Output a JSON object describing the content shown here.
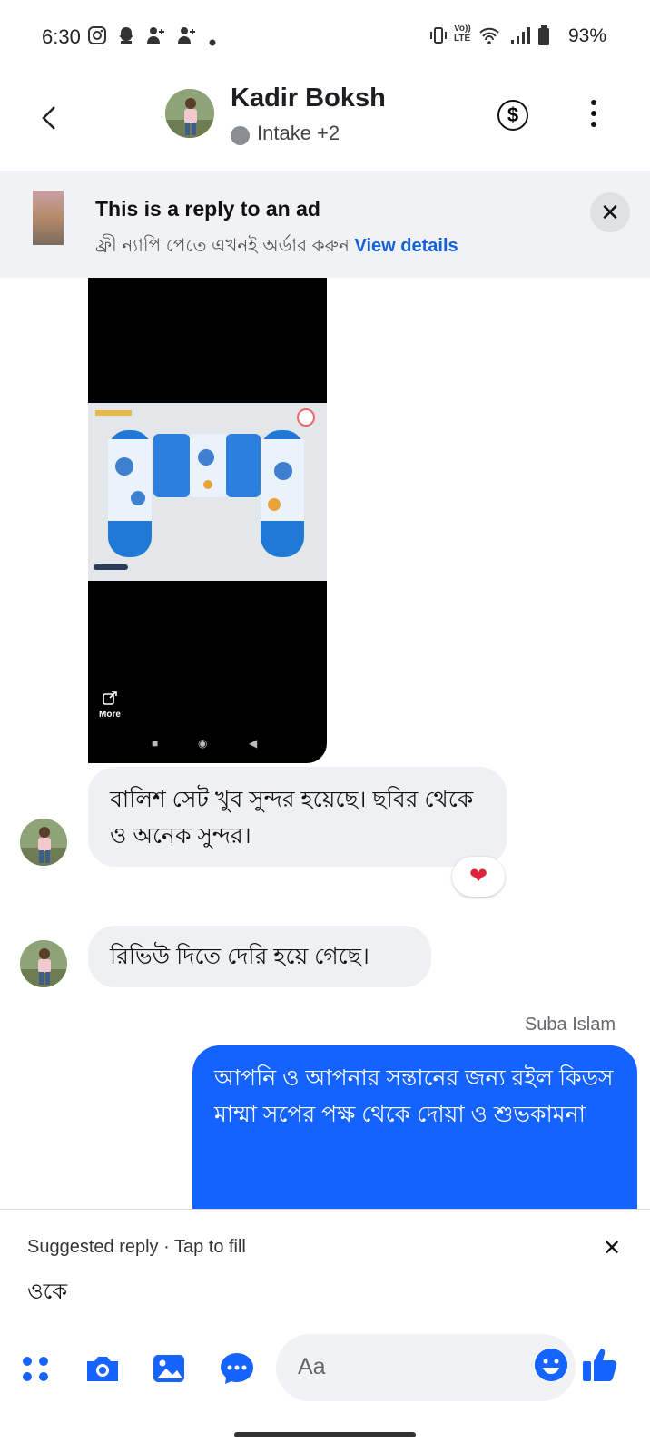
{
  "status_bar": {
    "time": "6:30",
    "battery": "93%",
    "network": "Vo))\nLTE"
  },
  "header": {
    "name": "Kadir Boksh",
    "subtitle": "Intake +2",
    "back_icon": "chevron-left-icon",
    "pay_icon": "dollar-icon",
    "menu_icon": "more-vertical-icon"
  },
  "ad_banner": {
    "title": "This is a reply to an ad",
    "subtitle": "ফ্রী ন্যাপি পেতে এখনই অর্ডার করুন",
    "link": "View details",
    "close": "✕"
  },
  "shared_image": {
    "more_label": "More"
  },
  "messages": [
    {
      "text": "বালিশ সেট খুব সুন্দর হয়েছে। ছবির থেকে ও অনেক সুন্দর।",
      "reaction": "❤"
    },
    {
      "text": "রিভিউ দিতে দেরি হয়ে গেছে।"
    },
    {
      "sender": "Suba Islam",
      "text": "আপনি ও আপনার সন্তানের জন্য রইল কিডস মাম্মা সপের পক্ষ থেকে দোয়া ও শুভকামনা"
    }
  ],
  "suggested_reply": {
    "label": "Suggested reply · Tap to fill",
    "text": "ওকে",
    "close": "✕"
  },
  "composer": {
    "placeholder": "Aa"
  },
  "colors": {
    "accent": "#1563ff",
    "bubble_in": "#eff0f3",
    "ad_bg": "#f0f2f5"
  }
}
